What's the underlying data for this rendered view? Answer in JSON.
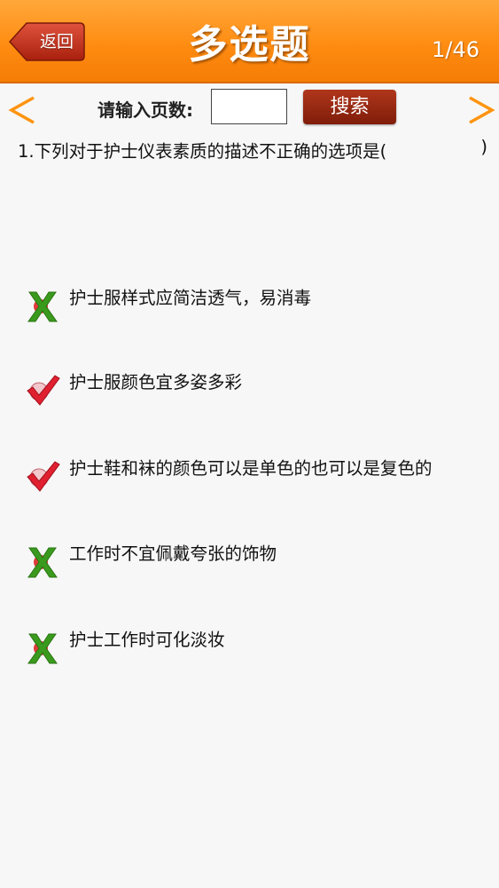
{
  "header": {
    "back_label": "返回",
    "title": "多选题",
    "page_counter": "1/46"
  },
  "pager": {
    "prev_icon": "chevron-left-icon",
    "next_icon": "chevron-right-icon",
    "page_input_label": "请输入页数:",
    "page_input_value": "",
    "search_label": "搜索"
  },
  "question": {
    "text": "1.下列对于护士仪表素质的描述不正确的选项是(",
    "close_paren": ")"
  },
  "options": [
    {
      "text": "护士服样式应简洁透气，易消毒",
      "mark": "x-mark-icon"
    },
    {
      "text": "护士服颜色宜多姿多彩",
      "mark": "check-mark-icon"
    },
    {
      "text": "护士鞋和袜的颜色可以是单色的也可以是复色的",
      "mark": "check-mark-icon"
    },
    {
      "text": "工作时不宜佩戴夸张的饰物",
      "mark": "x-mark-icon"
    },
    {
      "text": "护士工作时可化淡妆",
      "mark": "x-mark-icon"
    }
  ],
  "colors": {
    "header": "#ff8c12",
    "accent_arrow": "#ff9410",
    "search_button": "#9a2a12",
    "check": "#e02030",
    "cross": "#3a9a1e"
  }
}
